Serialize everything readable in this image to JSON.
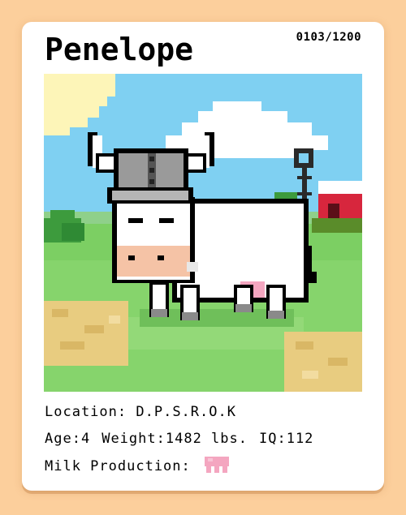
{
  "card": {
    "name": "Penelope",
    "serial": "0103/1200",
    "location_label": "Location:",
    "location_value": "D.P.S.R.O.K",
    "age_label": "Age:",
    "age_value": "4",
    "weight_label": "Weight:",
    "weight_value": "1482 lbs.",
    "iq_label": "IQ:",
    "iq_value": "112",
    "milk_label": "Milk Production:",
    "milk_icon": "udder-icon"
  },
  "colors": {
    "background": "#fccf9c",
    "card": "#ffffff",
    "sky": "#7fd0f2",
    "grass": "#7ccf63",
    "udder": "#f4a6c0"
  }
}
